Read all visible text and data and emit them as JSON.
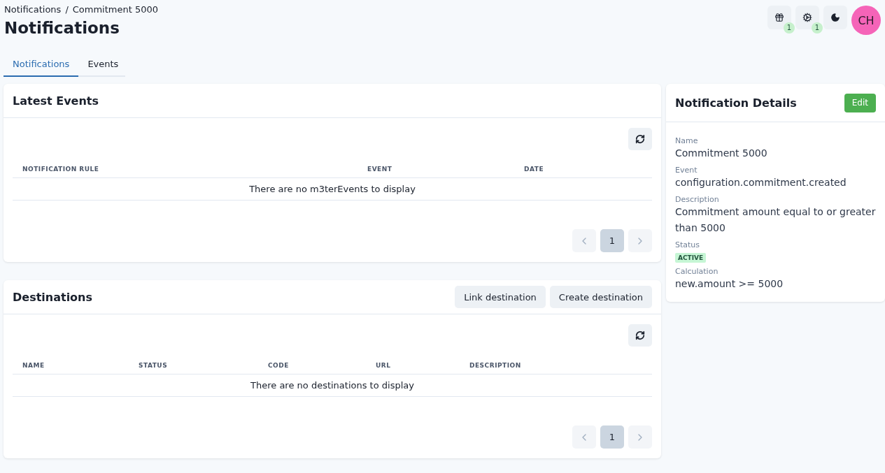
{
  "breadcrumb": [
    "Notifications",
    "Commitment 5000"
  ],
  "breadcrumb_separator": "/",
  "title": "Notifications",
  "header_actions": [
    {
      "kind": "gift",
      "badge": "1"
    },
    {
      "kind": "gears",
      "badge": "1"
    },
    {
      "kind": "moon"
    }
  ],
  "avatar": {
    "initials": "CH"
  },
  "tabs": [
    {
      "label": "Notifications",
      "selected": true
    },
    {
      "label": "Events",
      "selected": false
    }
  ],
  "sections": [
    {
      "title": "Latest Events",
      "columns": [
        "NOTIFICATION RULE",
        "EVENT",
        "DATE"
      ],
      "empty_message": "There are no m3terEvents to display",
      "pagination": {
        "prev_disabled": true,
        "next_disabled": true,
        "pages": [
          {
            "label": "1",
            "selected": true
          }
        ]
      }
    },
    {
      "title": "Destinations",
      "buttons": [
        "Link destination",
        "Create destination"
      ],
      "columns": [
        "NAME",
        "STATUS",
        "CODE",
        "URL",
        "DESCRIPTION"
      ],
      "empty_message": "There are no destinations to display",
      "pagination": {
        "prev_disabled": true,
        "next_disabled": true,
        "pages": [
          {
            "label": "1",
            "selected": true
          }
        ]
      }
    }
  ],
  "details": {
    "title": "Notification Details",
    "edit_button": "Edit",
    "fields": [
      {
        "label": "Name",
        "value": "Commitment 5000",
        "kind": "text"
      },
      {
        "label": "Event",
        "value": "configuration.commitment.created",
        "kind": "text"
      },
      {
        "label": "Description",
        "value": "Commitment amount equal to or greater than 5000",
        "kind": "text"
      },
      {
        "label": "Status",
        "value": "ACTIVE",
        "kind": "badge",
        "color": "#c6f6d5"
      },
      {
        "label": "Calculation",
        "value": "new.amount >= 5000",
        "kind": "text"
      }
    ]
  }
}
